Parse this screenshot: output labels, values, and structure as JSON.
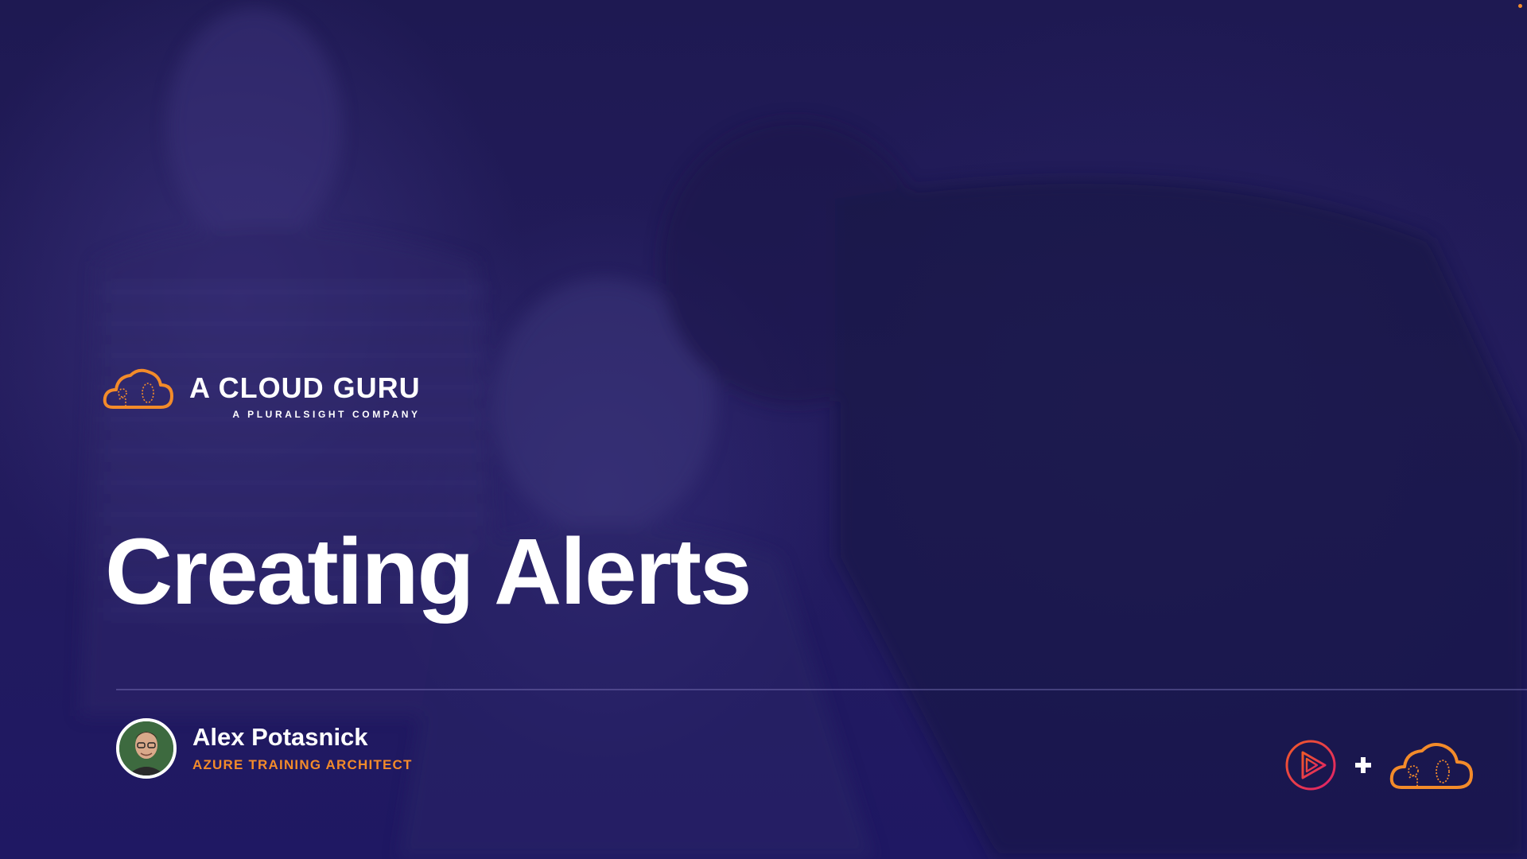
{
  "brand": {
    "name": "A CLOUD GURU",
    "tagline": "A PLURALSIGHT COMPANY",
    "logo_icon": "cloud-guru-icon"
  },
  "slide": {
    "title": "Creating Alerts"
  },
  "presenter": {
    "name": "Alex Potasnick",
    "role": "AZURE TRAINING ARCHITECT"
  },
  "partner_logos": {
    "left_icon": "pluralsight-play-icon",
    "separator_icon": "plus-icon",
    "right_icon": "cloud-guru-icon"
  },
  "colors": {
    "background": "#1c1650",
    "accent_orange": "#f38b2a",
    "pluralsight_pink": "#e8375c",
    "text_white": "#ffffff"
  }
}
